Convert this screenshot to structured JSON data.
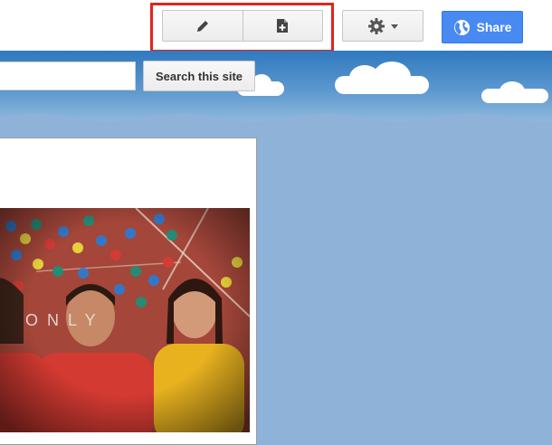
{
  "toolbar": {
    "edit_icon": "pencil-icon",
    "new_page_icon": "new-page-icon",
    "settings_icon": "gear-icon",
    "share": {
      "label": "Share",
      "icon": "globe-icon"
    }
  },
  "search": {
    "value": "",
    "button_label": "Search this site"
  },
  "photo": {
    "overlay_text": "ONLY",
    "description_icon": "team-photo"
  },
  "colors": {
    "share_blue": "#4889f2",
    "highlight_red": "#e0241b",
    "sky_blue": "#8fb2d9"
  }
}
